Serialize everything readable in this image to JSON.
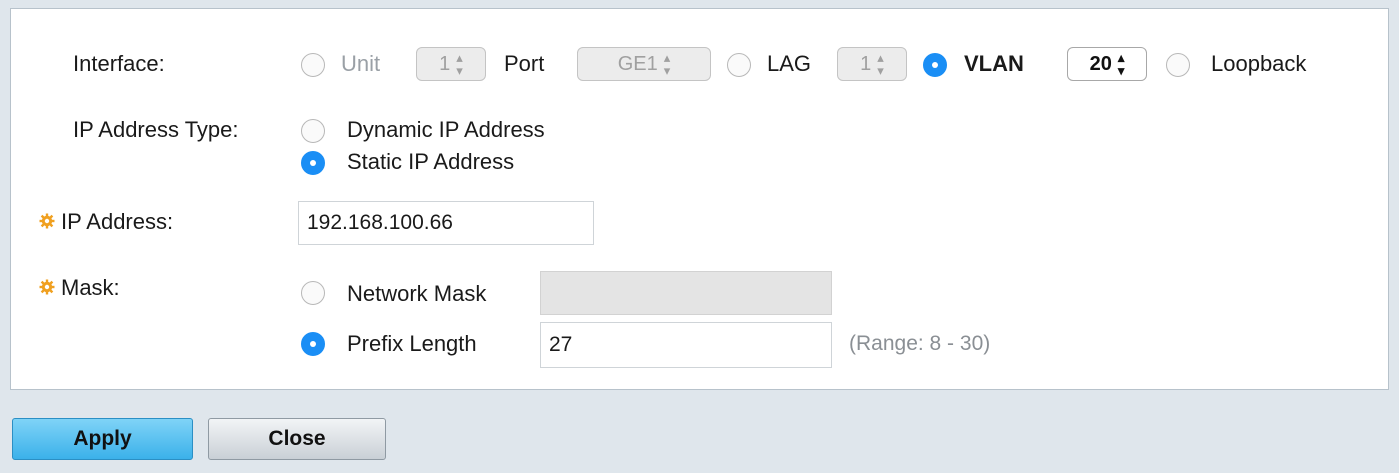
{
  "interface": {
    "label": "Interface:",
    "unit": {
      "label": "Unit",
      "value": "1",
      "selected": false,
      "disabled": true
    },
    "port": {
      "label": "Port",
      "value": "GE1",
      "disabled": true
    },
    "lag": {
      "label": "LAG",
      "value": "1",
      "selected": false,
      "disabled": true
    },
    "vlan": {
      "label": "VLAN",
      "value": "20",
      "selected": true
    },
    "loopback": {
      "label": "Loopback",
      "selected": false
    }
  },
  "ip_address_type": {
    "label": "IP Address Type:",
    "options": [
      {
        "label": "Dynamic IP Address",
        "selected": false
      },
      {
        "label": "Static IP Address",
        "selected": true
      }
    ]
  },
  "ip_address": {
    "label": "IP Address:",
    "value": "192.168.100.66"
  },
  "mask": {
    "label": "Mask:",
    "network_mask": {
      "label": "Network Mask",
      "value": "",
      "selected": false
    },
    "prefix_length": {
      "label": "Prefix Length",
      "value": "27",
      "selected": true,
      "range_hint": "(Range: 8 - 30)"
    }
  },
  "buttons": {
    "apply": "Apply",
    "close": "Close"
  },
  "colors": {
    "accent": "#1a8ef5",
    "required_icon": "#f0a020",
    "apply_button": "#3bb1ea"
  }
}
